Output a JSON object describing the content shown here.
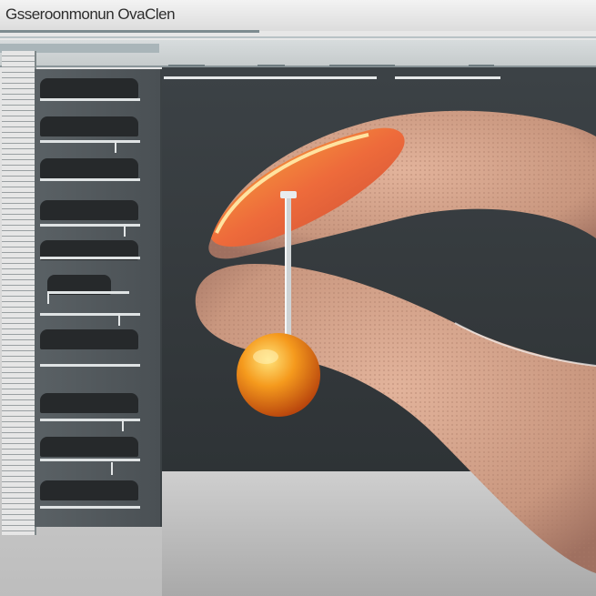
{
  "window": {
    "title": "Gsseroonmonun OvaClen"
  },
  "toolbar": {
    "tabs": [
      "",
      "",
      "",
      ""
    ]
  },
  "colors": {
    "sidebar": "#51585c",
    "canvas": "#383e41",
    "finger": "#d6a58c",
    "accent": "#f08a1a",
    "nail": "#e96b3a"
  },
  "icons": [
    "finger-icon",
    "pin-icon",
    "orange-ball-icon"
  ]
}
